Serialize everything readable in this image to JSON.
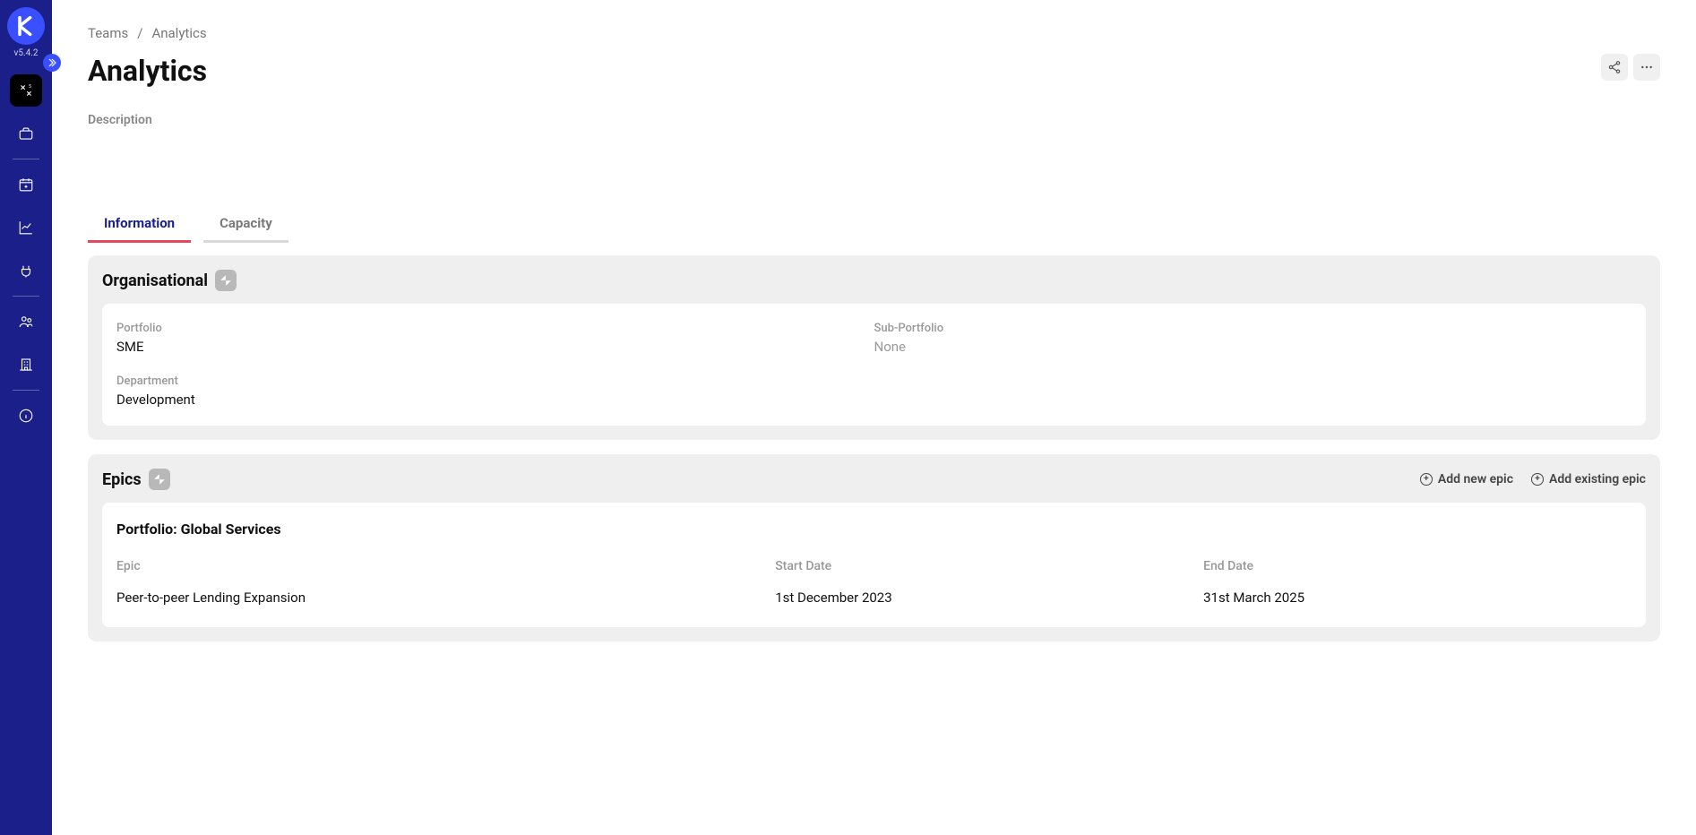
{
  "version": "v5.4.2",
  "breadcrumb": [
    "Teams",
    "/",
    "Analytics"
  ],
  "page_title": "Analytics",
  "desc_label": "Description",
  "tabs": [
    {
      "label": "Information",
      "active": true
    },
    {
      "label": "Capacity",
      "active": false
    }
  ],
  "org": {
    "title": "Organisational",
    "fields": {
      "portfolio_label": "Portfolio",
      "portfolio_value": "SME",
      "subportfolio_label": "Sub-Portfolio",
      "subportfolio_value": "None",
      "department_label": "Department",
      "department_value": "Development"
    }
  },
  "epics": {
    "title": "Epics",
    "add_new": "Add new epic",
    "add_existing": "Add existing epic",
    "portfolio_heading": "Portfolio: Global Services",
    "columns": {
      "epic": "Epic",
      "start": "Start Date",
      "end": "End Date"
    },
    "rows": [
      {
        "epic": "Peer-to-peer Lending Expansion",
        "start": "1st December 2023",
        "end": "31st March 2025"
      }
    ]
  }
}
